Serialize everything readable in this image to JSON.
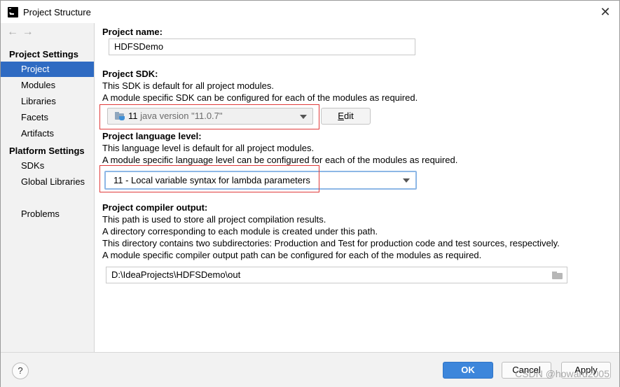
{
  "window": {
    "title": "Project Structure",
    "close_glyph": "✕"
  },
  "sidebar": {
    "back_glyph": "←",
    "forward_glyph": "→",
    "project_settings_header": "Project Settings",
    "project_settings_items": [
      "Project",
      "Modules",
      "Libraries",
      "Facets",
      "Artifacts"
    ],
    "platform_settings_header": "Platform Settings",
    "platform_settings_items": [
      "SDKs",
      "Global Libraries"
    ],
    "problems": "Problems",
    "selected_item": "Project"
  },
  "project_name": {
    "label": "Project name:",
    "value": "HDFSDemo"
  },
  "project_sdk": {
    "label": "Project SDK:",
    "line1": "This SDK is default for all project modules.",
    "line2": "A module specific SDK can be configured for each of the modules as required.",
    "selected_version": "11",
    "selected_detail": "java version \"11.0.7\"",
    "edit_button_underlined": "E",
    "edit_button_rest": "dit"
  },
  "language_level": {
    "label": "Project language level:",
    "line1": "This language level is default for all project modules.",
    "line2": "A module specific language level can be configured for each of the modules as required.",
    "selected": "11 - Local variable syntax for lambda parameters"
  },
  "compiler_output": {
    "label": "Project compiler output:",
    "line1": "This path is used to store all project compilation results.",
    "line2": "A directory corresponding to each module is created under this path.",
    "line3": "This directory contains two subdirectories: Production and Test for production code and test sources, respectively.",
    "line4": "A module specific compiler output path can be configured for each of the modules as required.",
    "path": "D:\\IdeaProjects\\HDFSDemo\\out"
  },
  "footer": {
    "help": "?",
    "ok": "OK",
    "cancel": "Cancel",
    "apply": "Apply"
  },
  "watermark": "CSDN @howard2005",
  "colors": {
    "selection": "#2f6bc2",
    "ok_button": "#3d86db",
    "highlight_box": "#e03a3a",
    "focus_border": "#8db7e6"
  },
  "icons": {
    "app": "intellij-icon",
    "sdk": "jdk-folder-icon",
    "browse": "folder-icon",
    "help": "help-icon"
  }
}
